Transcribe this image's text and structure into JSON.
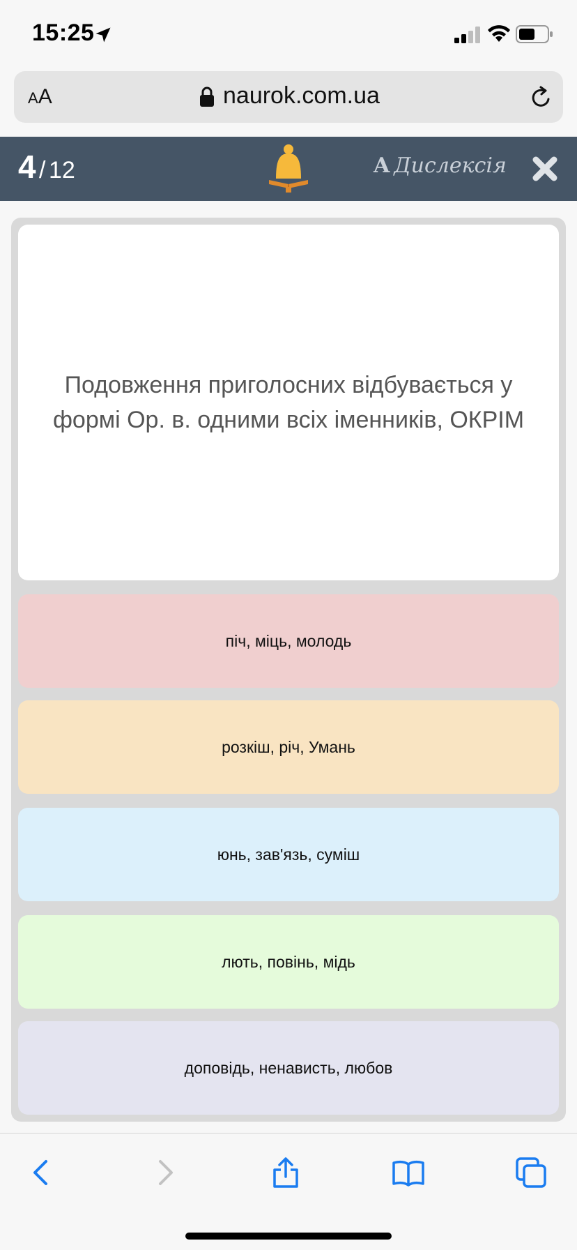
{
  "status": {
    "time": "15:25",
    "icons": [
      "location-arrow-icon",
      "signal-icon",
      "wifi-icon",
      "battery-icon"
    ]
  },
  "browser": {
    "aa_small": "A",
    "aa_large": "A",
    "url": "naurok.com.ua"
  },
  "quiz_header": {
    "current": "4",
    "separator": "/",
    "total": "12",
    "dyslexia_letter": "A",
    "dyslexia_label": "Дислексія"
  },
  "question": {
    "text": "Подовження приголосних відбувається у формі Ор. в. одними всіх іменників, ОКРІМ"
  },
  "answers": [
    {
      "label": "піч, міць, молодь",
      "color": "#f0cfcf"
    },
    {
      "label": "розкіш, річ, Умань",
      "color": "#f9e4c2"
    },
    {
      "label": "юнь, зав'язь, суміш",
      "color": "#dcf0fb"
    },
    {
      "label": "лють, повінь, мідь",
      "color": "#e5fbdb"
    },
    {
      "label": "доповідь, ненависть, любов",
      "color": "#e4e4f0"
    }
  ],
  "colors": {
    "header_bg": "#455566",
    "bell": "#f6b93b",
    "ios_blue": "#1a7cf0"
  }
}
